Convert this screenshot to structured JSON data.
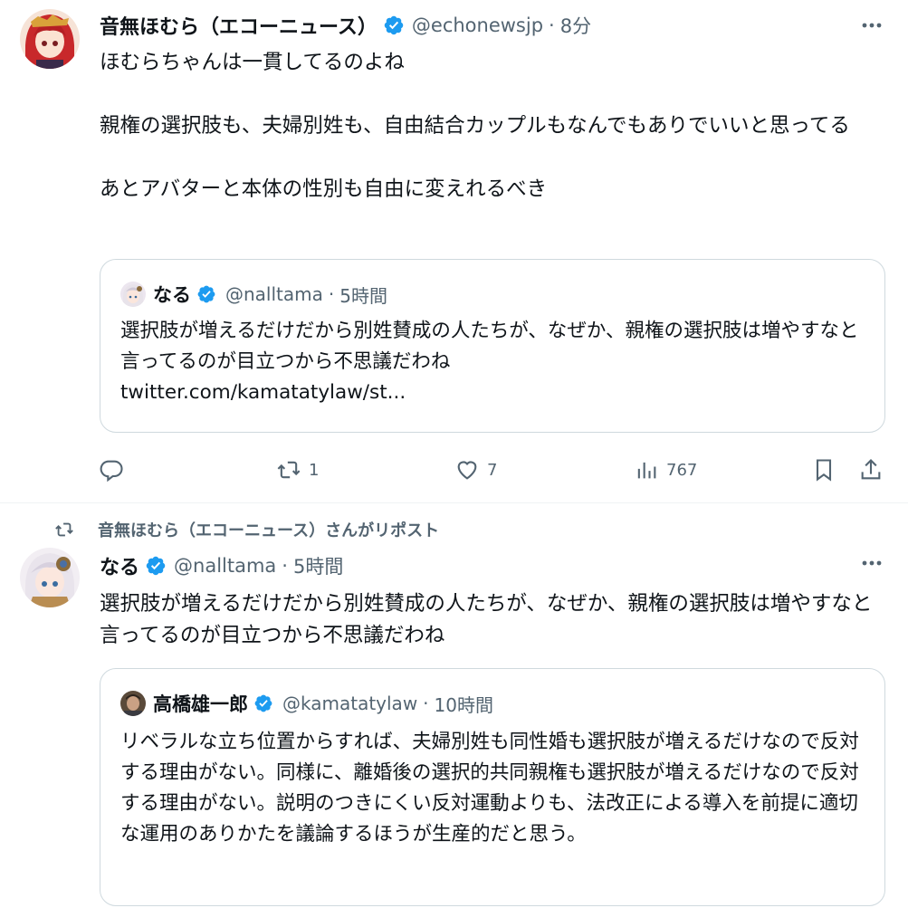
{
  "tweet1": {
    "author_name": "音無ほむら（エコーニュース）",
    "handle": "@echonewsjp",
    "separator": "·",
    "time": "8分",
    "text_lines": [
      "ほむらちゃんは一貫してるのよね",
      "親権の選択肢も、夫婦別姓も、自由結合カップルもなんでもありでいいと思ってる",
      "あとアバターと本体の性別も自由に変えれるべき"
    ],
    "quote": {
      "author_name": "なる",
      "handle": "@nalltama",
      "separator": "·",
      "time": "5時間",
      "text": "選択肢が増えるだけだから別姓賛成の人たちが、なぜか、親権の選択肢は増やすなと言ってるのが目立つから不思議だわね",
      "link": "twitter.com/kamatatylaw/st..."
    },
    "actions": {
      "reply_icon": "reply-icon",
      "retweet_icon": "retweet-icon",
      "retweet_count": "1",
      "like_icon": "heart-icon",
      "like_count": "7",
      "views_icon": "views-icon",
      "views_count": "767",
      "bookmark_icon": "bookmark-icon",
      "share_icon": "share-icon"
    }
  },
  "tweet2": {
    "repost_context": "音無ほむら（エコーニュース）さんがリポスト",
    "author_name": "なる",
    "handle": "@nalltama",
    "separator": "·",
    "time": "5時間",
    "text": "選択肢が増えるだけだから別姓賛成の人たちが、なぜか、親権の選択肢は増やすなと言ってるのが目立つから不思議だわね",
    "quote": {
      "author_name": "高橋雄一郎",
      "handle": "@kamatatylaw",
      "separator": "·",
      "time": "10時間",
      "text": "リベラルな立ち位置からすれば、夫婦別姓も同性婚も選択肢が増えるだけなので反対する理由がない。同様に、離婚後の選択的共同親権も選択肢が増えるだけなので反対する理由がない。説明のつきにくい反対運動よりも、法改正による導入を前提に適切な運用のありかたを議論するほうが生産的だと思う。"
    }
  },
  "colors": {
    "text": "#0f1419",
    "secondary": "#536471",
    "verified": "#1d9bf0",
    "border": "#cfd9de"
  }
}
